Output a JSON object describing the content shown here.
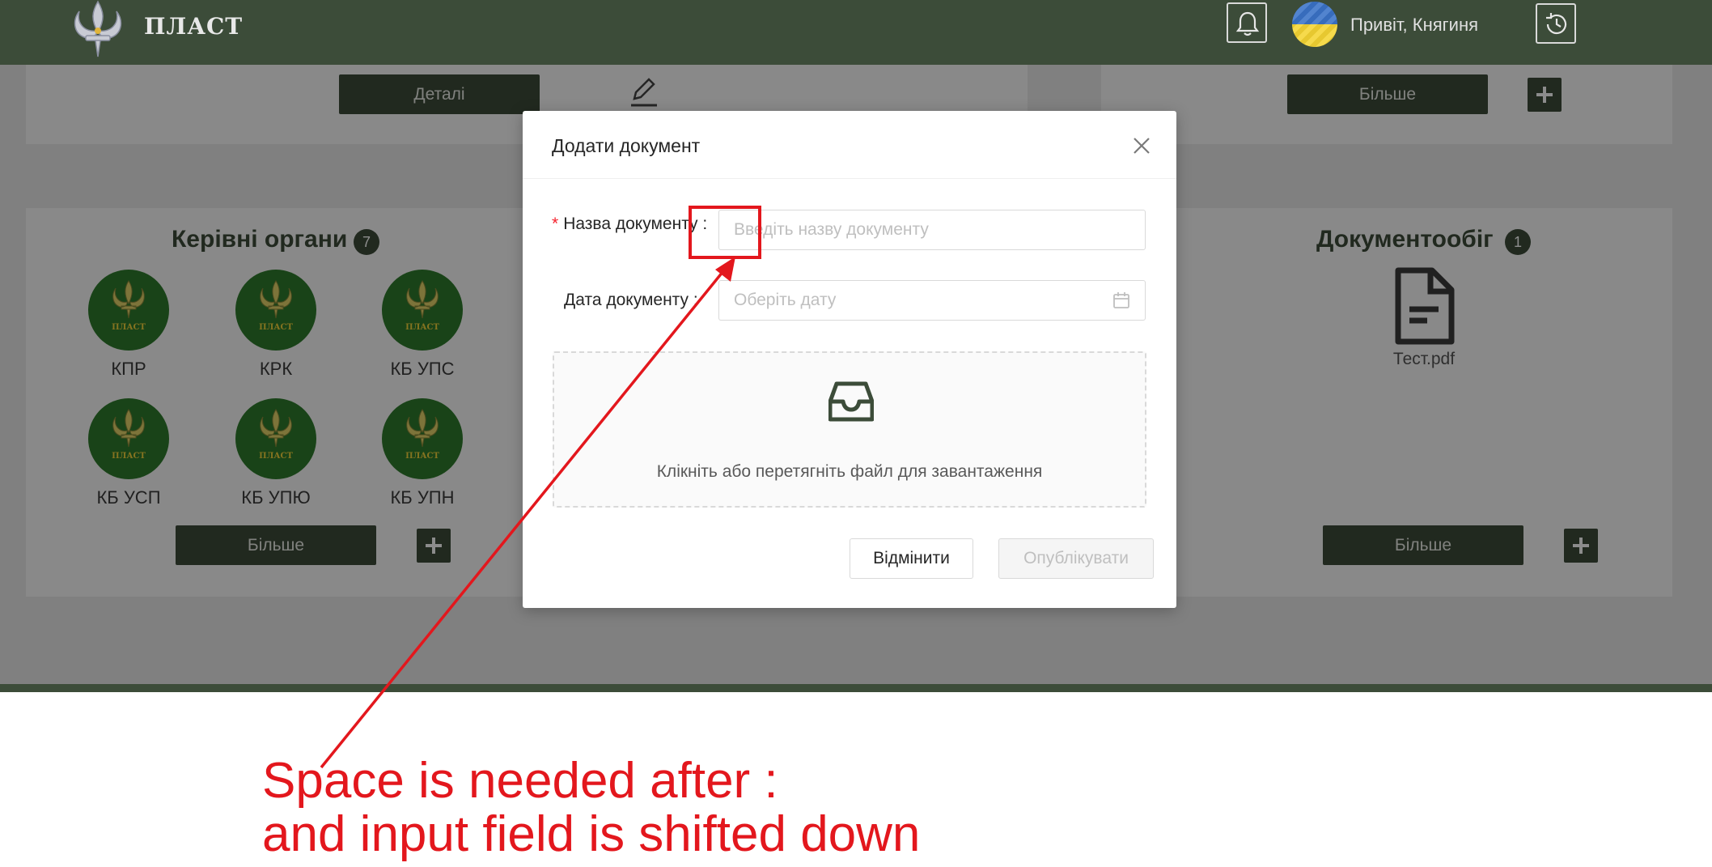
{
  "topbar": {
    "logo_text": "ПЛАСТ",
    "greeting": "Привіт, Княгиня",
    "icons": [
      "fleur-de-lis-logo-icon",
      "bell-icon",
      "history-clock-icon"
    ]
  },
  "background": {
    "top_left_card": {
      "details_label": "Деталі",
      "edit_icon": "pencil-icon"
    },
    "top_right_card": {
      "more_label": "Більше"
    },
    "governing_bodies": {
      "title": "Керівні органи",
      "count": "7",
      "emblem_text": "ПЛАСТ",
      "items": [
        {
          "label": "КПР"
        },
        {
          "label": "КРК"
        },
        {
          "label": "КБ УПС"
        },
        {
          "label": "КБ УСП"
        },
        {
          "label": "КБ УПЮ"
        },
        {
          "label": "КБ УПН"
        }
      ],
      "more_label": "Більше"
    },
    "document_flow": {
      "title": "Документообіг",
      "count": "1",
      "document": {
        "name": "Тест.pdf",
        "icon": "file-document-icon"
      },
      "more_label": "Більше"
    }
  },
  "modal": {
    "title": "Додати документ",
    "name_field": {
      "required_mark": "*",
      "label": "Назва документу :",
      "placeholder": "Введіть назву документу"
    },
    "date_field": {
      "label": "Дата документу :",
      "placeholder": "Оберіть дату"
    },
    "upload": {
      "text": "Клікніть або перетягніть файл для завантаження",
      "icon": "inbox-icon"
    },
    "cancel_label": "Відмінити",
    "publish_label": "Опублікувати"
  },
  "annotation": {
    "line1": "Space is needed after :",
    "line2": "and input field is shifted down",
    "color": "#e3171d"
  },
  "colors": {
    "brand_green": "#3c4c39",
    "emblem_green": "#2f7a2c",
    "required_red": "#f5222d"
  }
}
